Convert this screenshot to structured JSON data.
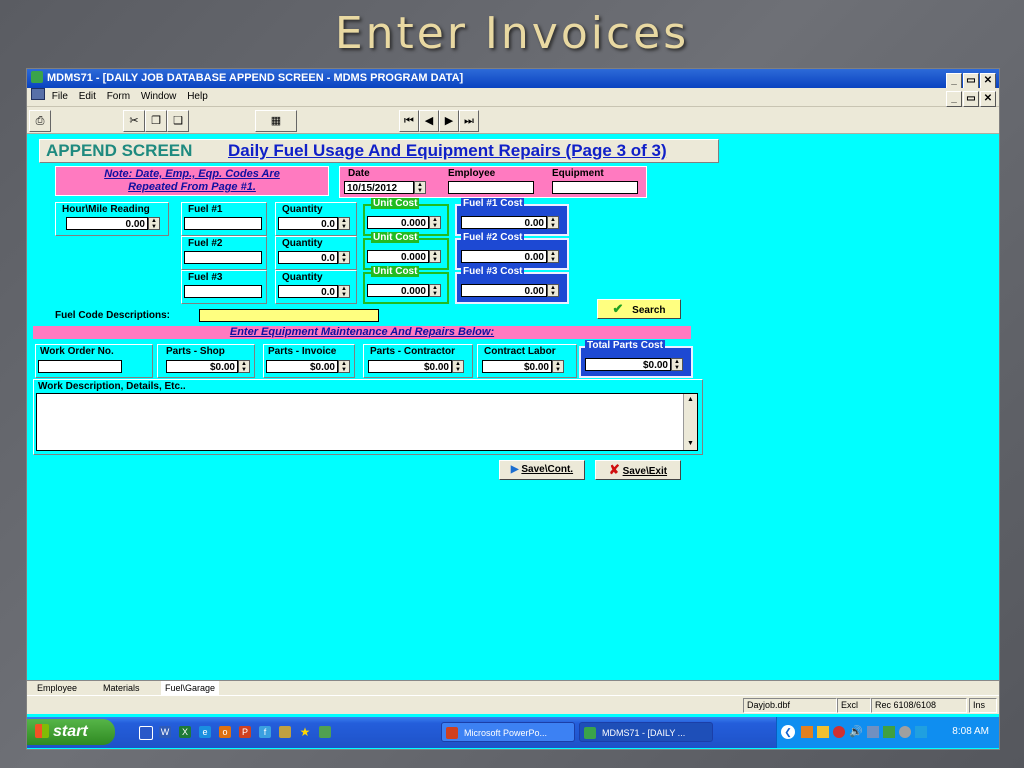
{
  "slide": {
    "title": "Enter Invoices"
  },
  "window": {
    "title": "MDMS71 - [DAILY JOB DATABASE APPEND SCREEN - MDMS PROGRAM DATA]",
    "controls": [
      "_",
      "Α",
      "✕"
    ]
  },
  "menu": {
    "items": [
      "File",
      "Edit",
      "Form",
      "Window",
      "Help"
    ]
  },
  "toolbar": {
    "nav": [
      "⏮",
      "◀",
      "▶",
      "⏭"
    ]
  },
  "form": {
    "append_label": "APPEND SCREEN",
    "heading": "Daily Fuel Usage And Equipment Repairs (Page 3 of 3)",
    "note_line1": "Note: Date, Emp., Eqp. Codes Are",
    "note_line2": "Repeated From Page #1.",
    "date_label": "Date",
    "date_value": "10/15/2012",
    "employee_label": "Employee",
    "employee_value": "",
    "equipment_label": "Equipment",
    "equipment_value": "",
    "hour_label": "Hour\\Mile Reading",
    "hour_value": "0.00",
    "fuel_rows": [
      {
        "fuel_label": "Fuel #1",
        "fuel_value": "",
        "qty_label": "Quantity",
        "qty_value": "0.0",
        "unit_label": "Unit Cost",
        "unit_value": "0.000",
        "cost_label": "Fuel #1 Cost",
        "cost_value": "0.00"
      },
      {
        "fuel_label": "Fuel #2",
        "fuel_value": "",
        "qty_label": "Quantity",
        "qty_value": "0.0",
        "unit_label": "Unit Cost",
        "unit_value": "0.000",
        "cost_label": "Fuel #2 Cost",
        "cost_value": "0.00"
      },
      {
        "fuel_label": "Fuel #3",
        "fuel_value": "",
        "qty_label": "Quantity",
        "qty_value": "0.0",
        "unit_label": "Unit Cost",
        "unit_value": "0.000",
        "cost_label": "Fuel #3 Cost",
        "cost_value": "0.00"
      }
    ],
    "fuel_code_label": "Fuel Code Descriptions:",
    "search_label": "Search",
    "maint_banner": "Enter Equipment Maintenance And Repairs Below:",
    "work_order_label": "Work Order No.",
    "parts_shop_label": "Parts - Shop",
    "parts_shop_value": "$0.00",
    "parts_invoice_label": "Parts - Invoice",
    "parts_invoice_value": "$0.00",
    "parts_contractor_label": "Parts - Contractor",
    "parts_contractor_value": "$0.00",
    "contract_labor_label": "Contract Labor",
    "contract_labor_value": "$0.00",
    "total_parts_label": "Total Parts Cost",
    "total_parts_value": "$0.00",
    "work_desc_label": "Work Description, Details, Etc..",
    "save_cont_label": "Save\\Cont.",
    "save_exit_label": "Save\\Exit"
  },
  "tabs": [
    "Employee",
    "Materials",
    "Fuel\\Garage"
  ],
  "status": {
    "file": "Dayjob.dbf",
    "mode": "Excl",
    "record": "Rec 6108/6108",
    "ins": "Ins"
  },
  "taskbar": {
    "start": "start",
    "tasks": [
      "Microsoft PowerPo...",
      "MDMS71 - [DAILY ..."
    ],
    "clock": "8:08 AM"
  },
  "colors": {
    "cyan_bg": "#00ffff",
    "pink": "#ff7ac0",
    "blue_group": "#1d49d3",
    "green_group": "#22bb22",
    "yellow_field": "#ffff80"
  }
}
